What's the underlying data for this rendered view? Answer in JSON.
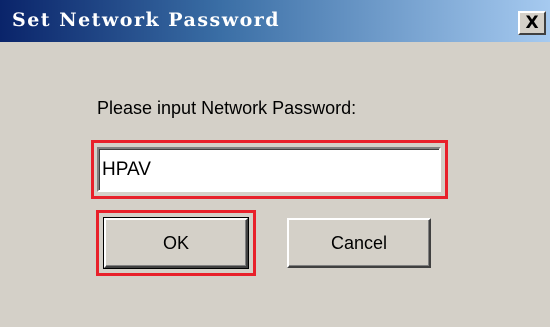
{
  "window": {
    "title": "Set Network Password",
    "close_label": "X"
  },
  "dialog": {
    "prompt": "Please input Network Password:",
    "password_value": "HPAV",
    "ok_label": "OK",
    "cancel_label": "Cancel"
  },
  "colors": {
    "titlebar_start": "#0a246a",
    "titlebar_end": "#a6caf0",
    "dialog_bg": "#d4d0c8",
    "highlight": "#e8202a"
  }
}
